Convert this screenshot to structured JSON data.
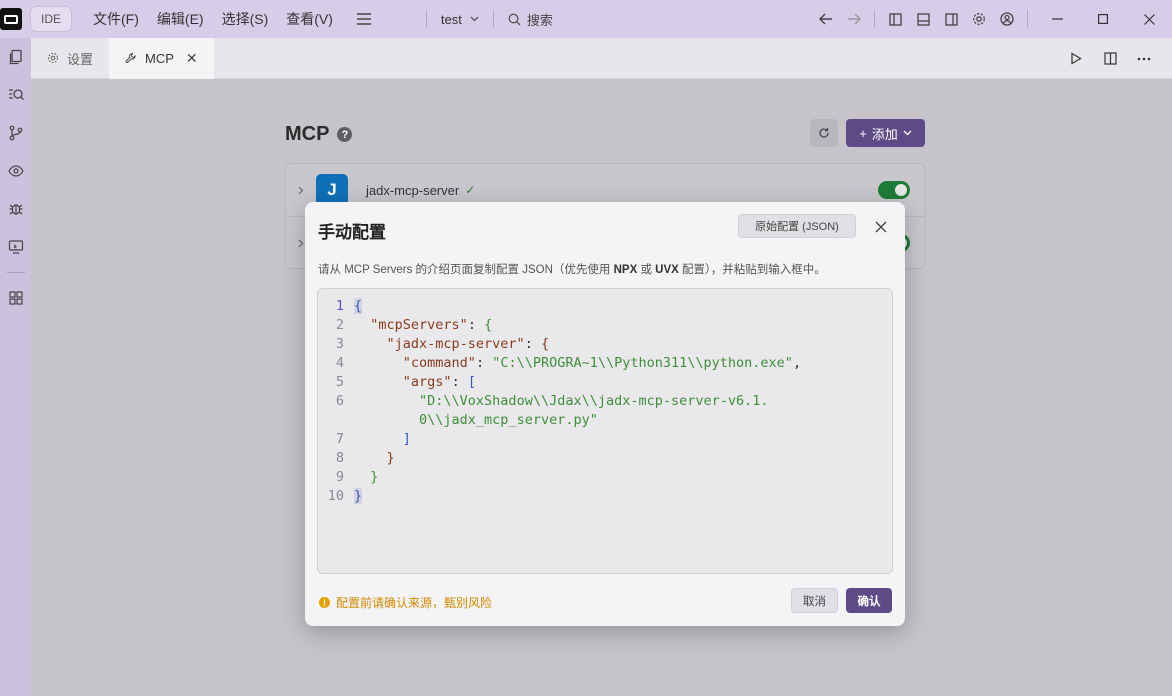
{
  "titlebar": {
    "ide_label": "IDE",
    "menu": [
      "文件(F)",
      "编辑(E)",
      "选择(S)",
      "查看(V)"
    ],
    "project": "test",
    "search": "搜索"
  },
  "tabs": [
    {
      "label": "设置"
    },
    {
      "label": "MCP"
    }
  ],
  "page": {
    "title": "MCP",
    "add_label": "添加"
  },
  "servers": [
    {
      "name": "jadx-mcp-server",
      "avatar": "J",
      "enabled": true,
      "status": "✓"
    }
  ],
  "modal": {
    "title": "手动配置",
    "raw_button": "原始配置 (JSON)",
    "desc_before": "请从 MCP Servers 的介绍页面复制配置 JSON（优先使用 ",
    "desc_npx": "NPX",
    "desc_or": " 或 ",
    "desc_uvx": "UVX",
    "desc_after": " 配置），并粘贴到输入框中。",
    "line_numbers": [
      "1",
      "2",
      "3",
      "4",
      "5",
      "6",
      "",
      "7",
      "8",
      "9",
      "10"
    ],
    "json_keys": {
      "mcpServers": "\"mcpServers\"",
      "server": "\"jadx-mcp-server\"",
      "command": "\"command\"",
      "command_val": "\"C:\\\\PROGRA~1\\\\Python311\\\\python.exe\"",
      "args": "\"args\"",
      "arg1_a": "\"D:\\\\VoxShadow\\\\Jdax\\\\jadx-mcp-server-v6.1.",
      "arg1_b": "0\\\\jadx_mcp_server.py\""
    },
    "warning": "配置前请确认来源，甄别风险",
    "cancel": "取消",
    "confirm": "确认"
  },
  "colors": {
    "accent": "#5d4a86",
    "toggle_on": "#1e7b38",
    "warning": "#d18a00"
  }
}
